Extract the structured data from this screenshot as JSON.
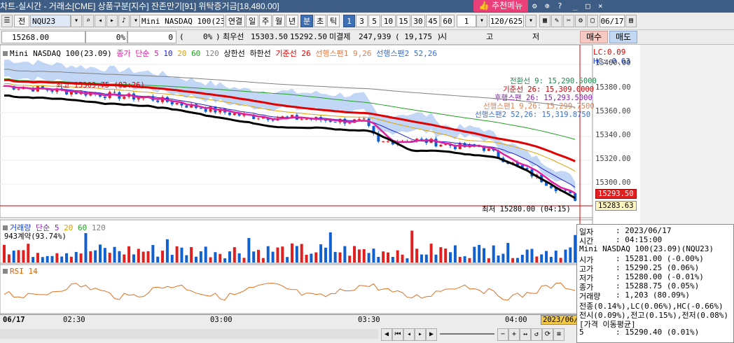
{
  "window": {
    "title": "차트-실시간 - 거래소[CME] 상품구분[지수] 잔존만기[91] 위탁증거금[18,480.00]"
  },
  "toolbar": {
    "mode_label": "전",
    "symbol": "NQU23",
    "product_name": "Mini NASDAQ 100(23.0",
    "buttons": [
      "연결",
      "일",
      "주",
      "월",
      "년",
      "분",
      "초",
      "틱"
    ],
    "selected_button": "분",
    "intervals": [
      "1",
      "3",
      "5",
      "10",
      "15",
      "30",
      "45",
      "60"
    ],
    "selected_interval": "1",
    "interval_value": "1",
    "count": "120/625",
    "date": "06/17",
    "recommend_button": "추천메뉴"
  },
  "quote": {
    "last_price": "15268.00",
    "change_pct": "0%",
    "change": "0",
    "change_paren": "(",
    "change_pct2": "0%",
    "change_paren_close": ")",
    "best_bid_label": "최우선",
    "best_bid": "15303.50",
    "best_ask": "15292.50",
    "unfilled_label": "미결제",
    "open_interest": "247,939",
    "oi_change": "( 19,175 )",
    "market_label": "시",
    "high_label": "고",
    "low_label": "저",
    "buy_button": "매수",
    "sell_button": "매도"
  },
  "price_pane": {
    "legend": {
      "title": "Mini NASDAQ 100(23.09)",
      "ma_label": "종가 단순",
      "ma_periods": [
        "5",
        "10",
        "20",
        "60",
        "120"
      ],
      "upper_limit": "상한선",
      "lower_limit": "하한선",
      "base_line": "기준선 26",
      "span1": "선행스팬1 9,26",
      "span2": "선행스팬2 52,26"
    },
    "ichimoku_values": {
      "conversion": "전환선 9: 15,290.5000",
      "base": "기준선 26: 15,309.0000",
      "lagging": "후행스팬 26: 15,293.5000",
      "span1": "선행스팬1 9,26: 15,299.7500",
      "span2": "선행스팬2 52,26: 15,319.8750"
    },
    "lc": "LC:0.09",
    "hc": "HC:-0.63",
    "annotation_high": "최고 15309.75 (02:26)",
    "annotation_low": "최저 15280.00 (04:15)",
    "current_price_tag": "15293.50",
    "cursor_price_tag": "15283.63",
    "y_ticks": [
      "15400.00",
      "15380.00",
      "15360.00",
      "15340.00",
      "15320.00",
      "15300.00"
    ]
  },
  "volume_pane": {
    "legend": {
      "title": "거래량",
      "ma_label": "단순",
      "periods": [
        "5",
        "20",
        "60",
        "120"
      ]
    },
    "contracts": "943계약(93.74%)"
  },
  "rsi_pane": {
    "legend": "RSI 14"
  },
  "time_axis": {
    "labels": [
      "06/17",
      "02:30",
      "03:00",
      "03:30",
      "04:00"
    ],
    "cursor_label": "2023/06/"
  },
  "info_panel": {
    "rows": [
      [
        "일자",
        ": 2023/06/17"
      ],
      [
        "시간",
        ": 04:15:00"
      ],
      [
        "Mini NASDAQ 100(23.09)(NQU23)",
        ""
      ],
      [
        "시가",
        ": 15281.00 (-0.00%)"
      ],
      [
        "고가",
        ": 15290.25 (0.06%)"
      ],
      [
        "저가",
        ": 15280.00 (-0.01%)"
      ],
      [
        "종가",
        ": 15288.75 (0.05%)"
      ],
      [
        "거래량",
        ": 1,203 (80.09%)"
      ],
      [
        "전종(0.14%),LC(0.06%),HC(-0.66%)",
        ""
      ],
      [
        "전시(0.09%),전고(0.15%),전저(0.08%)",
        ""
      ],
      [
        "[가격 이동평균]",
        ""
      ],
      [
        "5",
        ": 15290.40 (0.01%)"
      ]
    ]
  },
  "colors": {
    "title_bg": "#3d5d85",
    "candle_up": "#e02020",
    "candle_down": "#1060d0",
    "ma5": "#e020a0",
    "ma10": "#2020d0",
    "ma20": "#e0a000",
    "ma60": "#20a020",
    "ma120": "#808080",
    "base_line": "#e00000",
    "cloud": "#8fb4ee"
  }
}
